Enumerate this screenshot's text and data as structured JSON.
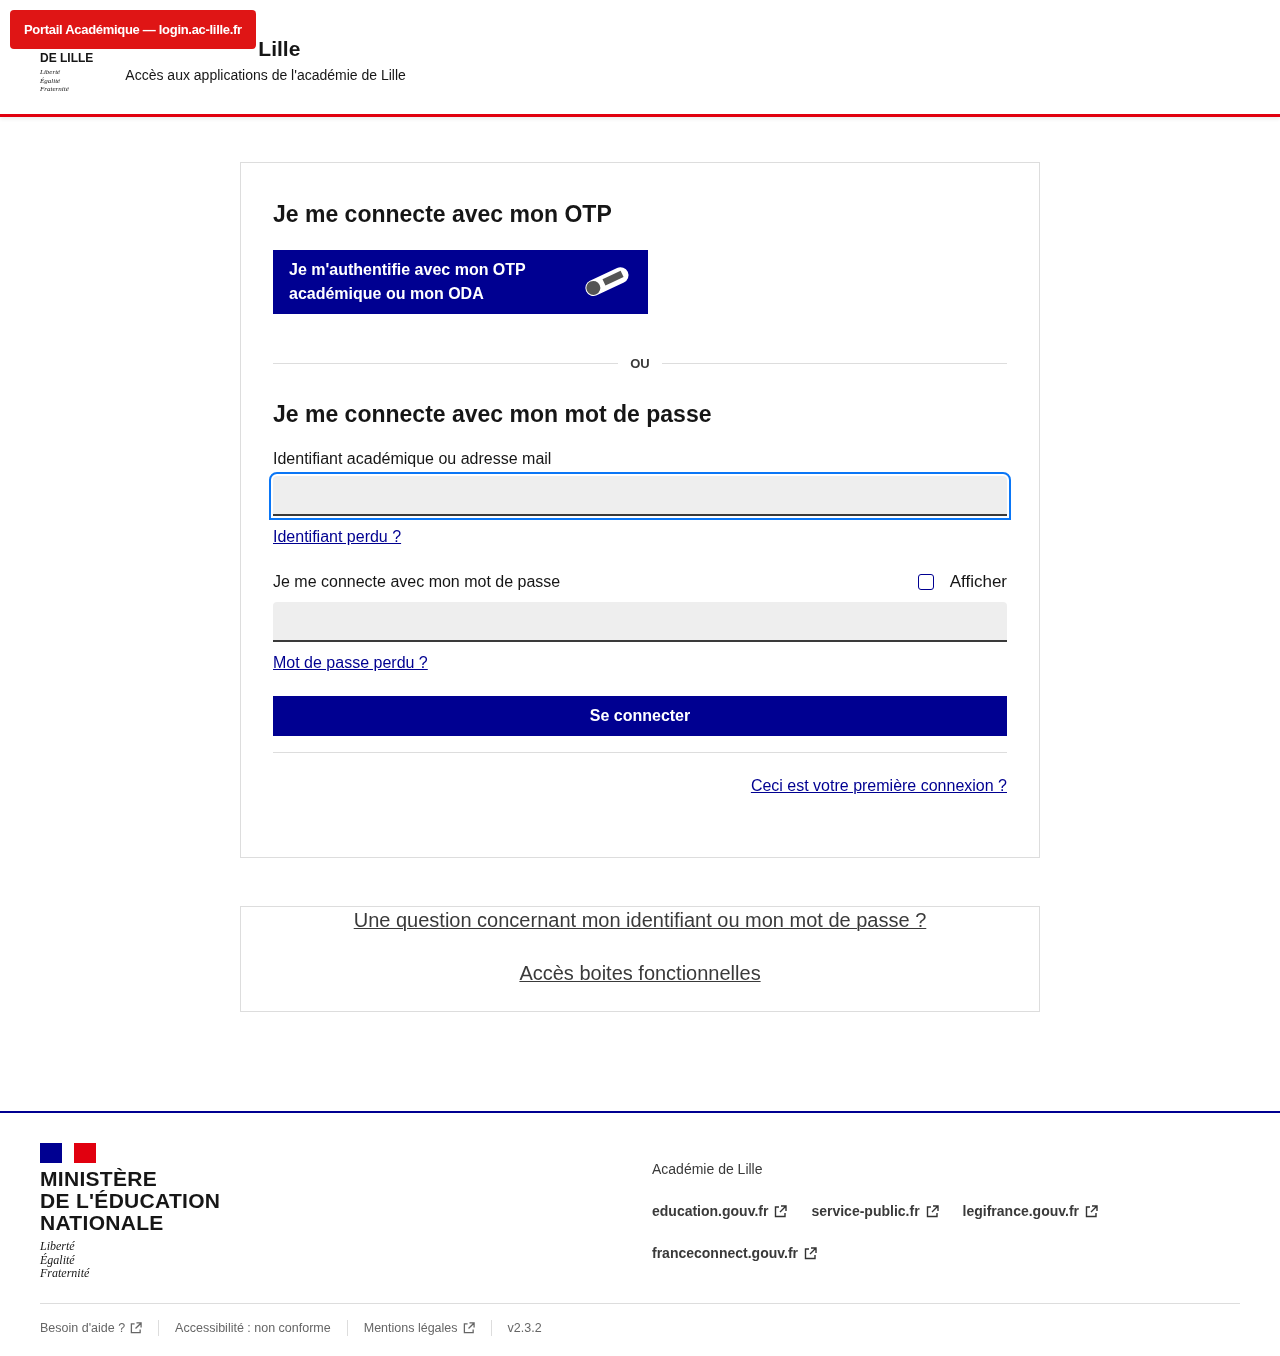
{
  "tooltip": "Portail Académique — login.ac-lille.fr",
  "header": {
    "logo_lines": [
      "DE LILLE"
    ],
    "motto": [
      "Liberté",
      "Égalité",
      "Fraternité"
    ],
    "title": "Lille",
    "subtitle": "Accès aux applications de l'académie de Lille"
  },
  "otp": {
    "heading": "Je me connecte avec mon OTP",
    "button": [
      "Je m'authentifie avec mon OTP",
      "académique ou mon ODA"
    ]
  },
  "separator": "OU",
  "password_section": {
    "heading": "Je me connecte avec mon mot de passe",
    "id_field": {
      "label": "Identifiant académique ou adresse mail",
      "focused": true
    },
    "id_link": "Identifiant perdu ?",
    "pw_field": {
      "label": "Je me connecte avec mon mot de passe",
      "focused": false
    },
    "show_checkbox": {
      "label": "Afficher",
      "checked": false
    },
    "pw_link": "Mot de passe perdu ?",
    "submit": "Se connecter",
    "first_login_link": "Ceci est votre première connexion ?"
  },
  "help_links": [
    "Une question concernant mon identifiant ou mon mot de passe ?",
    "Accès boites fonctionnelles"
  ],
  "footer": {
    "ministry": [
      "MINISTÈRE",
      "DE L'ÉDUCATION",
      "NATIONALE"
    ],
    "motto": [
      "Liberté",
      "Égalité",
      "Fraternité"
    ],
    "org": "Académie de Lille",
    "links": [
      {
        "label": "education.gouv.fr",
        "external": true
      },
      {
        "label": "service-public.fr",
        "external": true
      },
      {
        "label": "legifrance.gouv.fr",
        "external": true
      },
      {
        "label": "franceconnect.gouv.fr",
        "external": true
      }
    ],
    "bottom_links": [
      {
        "label": "Besoin d'aide ?",
        "external": true
      },
      {
        "label": "Accessibilité : non conforme",
        "external": false
      },
      {
        "label": "Mentions légales",
        "external": true
      },
      {
        "label": "v2.3.2",
        "external": false
      }
    ]
  }
}
